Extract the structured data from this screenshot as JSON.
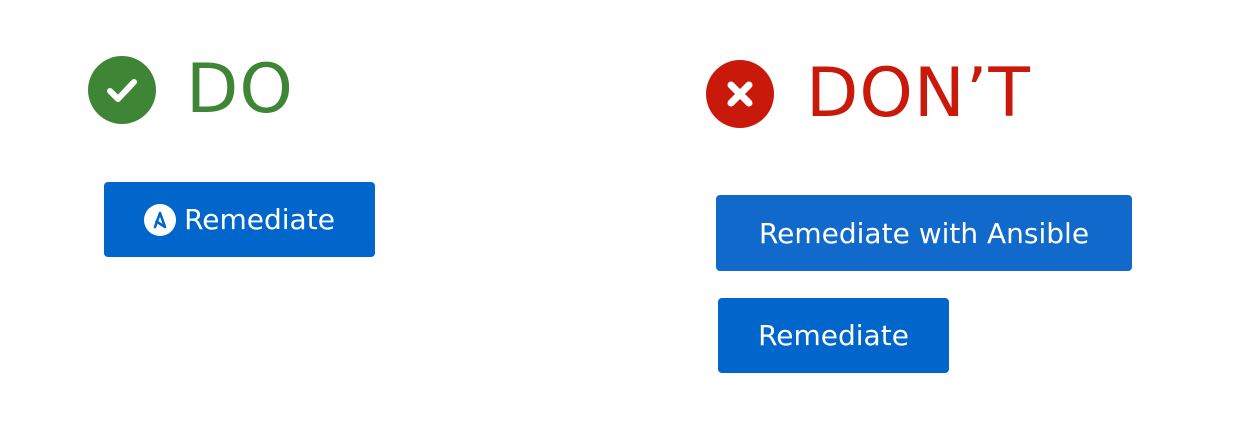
{
  "colors": {
    "do_green": "#3e8635",
    "dont_red": "#c9190b",
    "button_blue": "#0066cc",
    "button_blue_alt": "#116acb",
    "white": "#ffffff"
  },
  "do_section": {
    "icon": "check-circle-icon",
    "label": "DO",
    "button": {
      "icon": "ansible-logo-icon",
      "label": "Remediate"
    }
  },
  "dont_section": {
    "icon": "times-circle-icon",
    "label": "DON’T",
    "buttons": [
      {
        "label": "Remediate with Ansible"
      },
      {
        "label": "Remediate"
      }
    ]
  }
}
